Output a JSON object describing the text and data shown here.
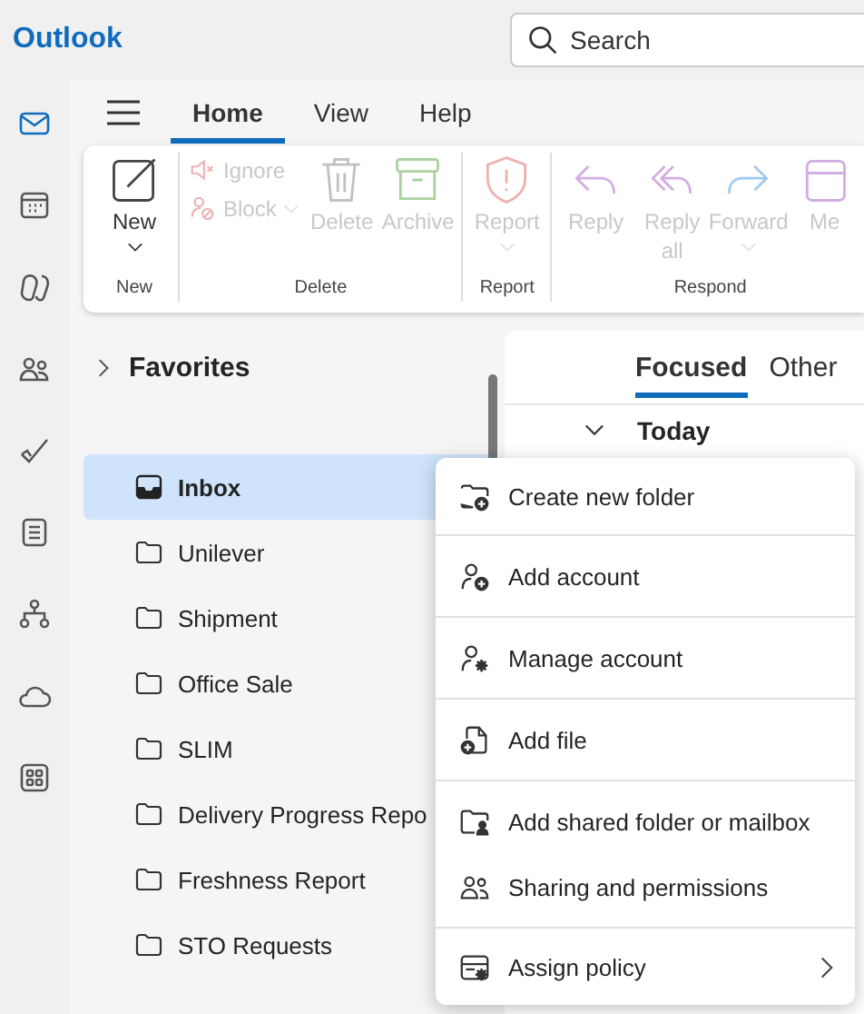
{
  "app": {
    "title": "Outlook"
  },
  "search": {
    "placeholder": "Search"
  },
  "rail": [
    {
      "selected": true
    },
    {
      "selected": false
    },
    {
      "selected": false
    },
    {
      "selected": false
    },
    {
      "selected": false
    },
    {
      "selected": false
    },
    {
      "selected": false
    },
    {
      "selected": false
    },
    {
      "selected": false
    }
  ],
  "ribbon_tabs": [
    {
      "label": "Home",
      "selected": true
    },
    {
      "label": "View",
      "selected": false
    },
    {
      "label": "Help",
      "selected": false
    }
  ],
  "ribbon_groups": [
    {
      "label": "New",
      "buttons": [
        {
          "label": "New",
          "kind": "large",
          "disabled": false,
          "dropdown": true
        }
      ]
    },
    {
      "label": "Delete",
      "buttons": [
        {
          "label": "Ignore",
          "kind": "small",
          "disabled": true,
          "dropdown": false
        },
        {
          "label": "Block",
          "kind": "small",
          "disabled": true,
          "dropdown": true
        },
        {
          "label": "Delete",
          "kind": "large",
          "disabled": true,
          "dropdown": false
        },
        {
          "label": "Archive",
          "kind": "large",
          "disabled": true,
          "dropdown": false
        }
      ]
    },
    {
      "label": "Report",
      "buttons": [
        {
          "label": "Report",
          "kind": "large",
          "disabled": true,
          "dropdown": true
        }
      ]
    },
    {
      "label": "Respond",
      "buttons": [
        {
          "label": "Reply",
          "kind": "large",
          "disabled": true,
          "dropdown": false
        },
        {
          "label": "Reply all",
          "kind": "large",
          "disabled": true,
          "dropdown": false
        },
        {
          "label": "Forward",
          "kind": "large",
          "disabled": true,
          "dropdown": true
        },
        {
          "label": "Me",
          "kind": "large",
          "disabled": true,
          "dropdown": false
        }
      ]
    }
  ],
  "folders": {
    "favorites": {
      "label": "Favorites",
      "expanded": false
    },
    "items": [
      {
        "label": "Inbox",
        "kind": "inbox",
        "selected": true
      },
      {
        "label": "Unilever",
        "kind": "folder",
        "selected": false
      },
      {
        "label": "Shipment",
        "kind": "folder",
        "selected": false
      },
      {
        "label": "Office Sale",
        "kind": "folder",
        "selected": false
      },
      {
        "label": "SLIM",
        "kind": "folder",
        "selected": false
      },
      {
        "label": "Delivery Progress Repo",
        "kind": "folder",
        "selected": false
      },
      {
        "label": "Freshness Report",
        "kind": "folder",
        "selected": false
      },
      {
        "label": "STO Requests",
        "kind": "folder",
        "selected": false
      }
    ]
  },
  "message_list": {
    "tabs": [
      {
        "label": "Focused",
        "selected": true
      },
      {
        "label": "Other",
        "selected": false
      }
    ],
    "group": {
      "label": "Today",
      "expanded": true
    }
  },
  "context_menu": {
    "sections": [
      [
        {
          "label": "Create new folder",
          "submenu": false
        }
      ],
      [
        {
          "label": "Add account",
          "submenu": false
        }
      ],
      [
        {
          "label": "Manage account",
          "submenu": false
        }
      ],
      [
        {
          "label": "Add file",
          "submenu": false
        }
      ],
      [
        {
          "label": "Add shared folder or mailbox",
          "submenu": false
        },
        {
          "label": "Sharing and permissions",
          "submenu": false
        }
      ],
      [
        {
          "label": "Assign policy",
          "submenu": true
        }
      ]
    ]
  }
}
